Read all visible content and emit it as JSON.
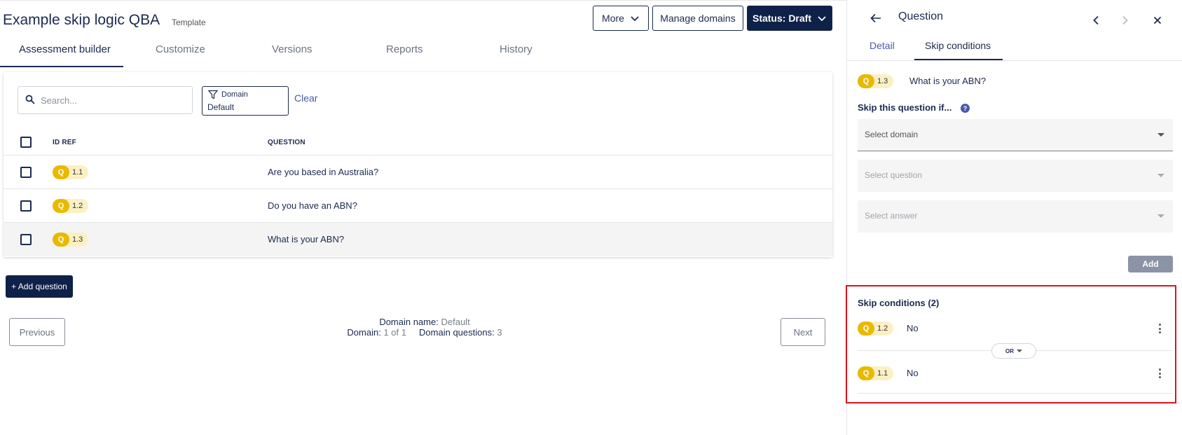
{
  "header": {
    "title": "Example skip logic QBA",
    "subtitle": "Template",
    "more_label": "More",
    "manage_domains_label": "Manage domains",
    "status_label": "Status: Draft"
  },
  "tabs": [
    {
      "label": "Assessment builder",
      "active": true
    },
    {
      "label": "Customize",
      "active": false
    },
    {
      "label": "Versions",
      "active": false
    },
    {
      "label": "Reports",
      "active": false
    },
    {
      "label": "History",
      "active": false
    }
  ],
  "filters": {
    "search_placeholder": "Search...",
    "domain_label": "Domain",
    "domain_value": "Default",
    "clear_label": "Clear"
  },
  "table": {
    "columns": [
      "ID REF",
      "QUESTION"
    ],
    "rows": [
      {
        "badge": "Q",
        "id": "1.1",
        "question": "Are you based in Australia?",
        "selected": false
      },
      {
        "badge": "Q",
        "id": "1.2",
        "question": "Do you have an ABN?",
        "selected": false
      },
      {
        "badge": "Q",
        "id": "1.3",
        "question": "What is your ABN?",
        "selected": true
      }
    ]
  },
  "actions": {
    "add_question": "+ Add question",
    "previous": "Previous",
    "next": "Next"
  },
  "footer": {
    "domain_name_label": "Domain name:",
    "domain_name_value": "Default",
    "domain_label": "Domain:",
    "domain_value": "1 of 1",
    "domain_questions_label": "Domain questions:",
    "domain_questions_value": "3"
  },
  "panel": {
    "title": "Question",
    "tabs": [
      {
        "label": "Detail",
        "active": false
      },
      {
        "label": "Skip conditions",
        "active": true
      }
    ],
    "current_question": {
      "badge": "Q",
      "id": "1.3",
      "text": "What is your ABN?"
    },
    "skip_heading": "Skip this question if...",
    "select_domain": "Select domain",
    "select_question": "Select question",
    "select_answer": "Select answer",
    "add_label": "Add",
    "conditions_title": "Skip conditions (2)",
    "operator": "OR",
    "conditions": [
      {
        "badge": "Q",
        "id": "1.2",
        "answer": "No"
      },
      {
        "badge": "Q",
        "id": "1.1",
        "answer": "No"
      }
    ]
  },
  "colors": {
    "primary_navy": "#0e2148",
    "badge_yellow": "#e9b900",
    "badge_light": "#fbf0c4",
    "link_blue": "#4a5aa8",
    "highlight_red": "#e0101a"
  }
}
